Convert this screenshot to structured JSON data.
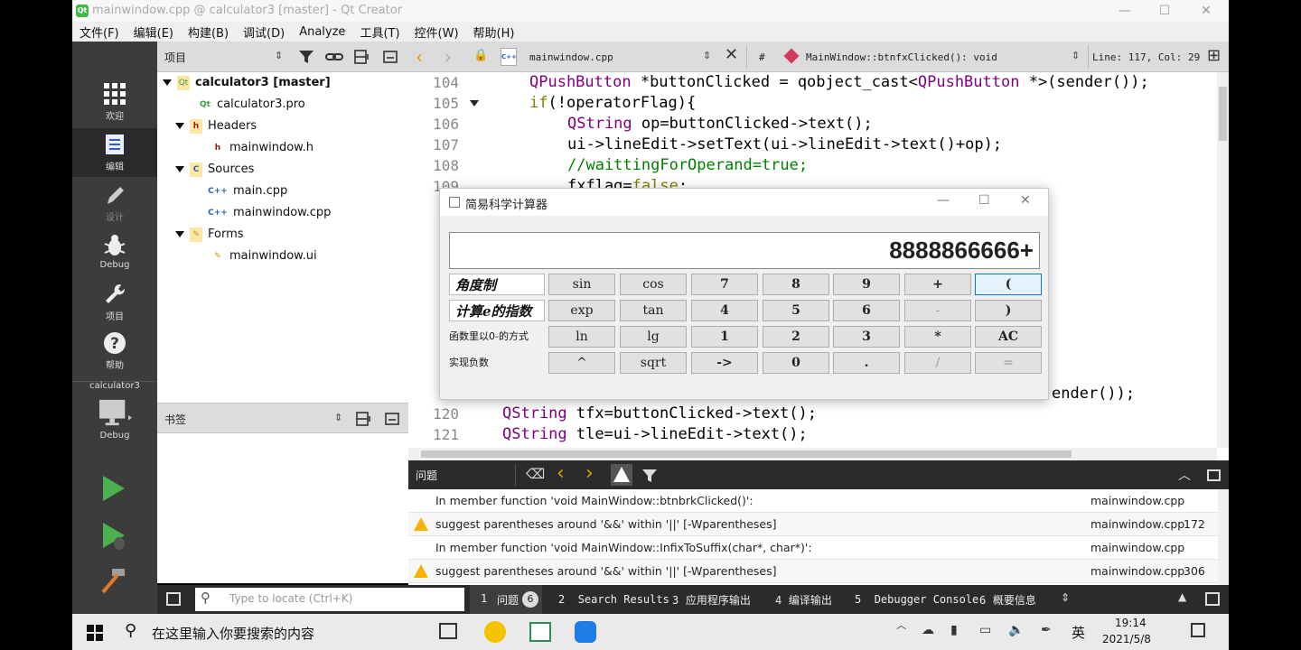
{
  "window": {
    "title": "mainwindow.cpp @ calculator3 [master] - Qt Creator",
    "minimize": "—",
    "maximize": "☐",
    "close": "✕"
  },
  "menu": [
    "文件(F)",
    "编辑(E)",
    "构建(B)",
    "调试(D)",
    "Analyze",
    "工具(T)",
    "控件(W)",
    "帮助(H)"
  ],
  "modes": [
    {
      "label": "欢迎",
      "icon": "grid-icon"
    },
    {
      "label": "编辑",
      "icon": "edit-doc-icon"
    },
    {
      "label": "设计",
      "icon": "pencil-icon"
    },
    {
      "label": "Debug",
      "icon": "bug-icon"
    },
    {
      "label": "项目",
      "icon": "wrench-icon"
    },
    {
      "label": "帮助",
      "icon": "help-icon"
    }
  ],
  "target": {
    "name": "calculator3",
    "mode": "Debug"
  },
  "project_panel": {
    "title": "项目",
    "tree": [
      {
        "label": "calculator3 [master]",
        "level": 0,
        "bold": true,
        "expanded": true,
        "icon": "project-icon"
      },
      {
        "label": "calculator3.pro",
        "level": 1,
        "icon": "pro-file-icon"
      },
      {
        "label": "Headers",
        "level": 1,
        "expanded": true,
        "icon": "headers-folder-icon"
      },
      {
        "label": "mainwindow.h",
        "level": 2,
        "icon": "header-file-icon"
      },
      {
        "label": "Sources",
        "level": 1,
        "expanded": true,
        "icon": "sources-folder-icon"
      },
      {
        "label": "main.cpp",
        "level": 2,
        "icon": "cpp-file-icon"
      },
      {
        "label": "mainwindow.cpp",
        "level": 2,
        "icon": "cpp-file-icon"
      },
      {
        "label": "Forms",
        "level": 1,
        "expanded": true,
        "icon": "forms-folder-icon"
      },
      {
        "label": "mainwindow.ui",
        "level": 2,
        "icon": "ui-file-icon"
      }
    ]
  },
  "bookmarks_panel": {
    "title": "书签"
  },
  "editor_toolbar": {
    "file": "mainwindow.cpp",
    "hash": "#",
    "function": "MainWindow::btnfxClicked(): void",
    "position": "Line: 117, Col: 29"
  },
  "code_lines": [
    {
      "n": "104",
      "fold": false,
      "indent": 8,
      "text": "QPushButton *buttonClicked = qobject_cast<QPushButton *>(sender());"
    },
    {
      "n": "105",
      "fold": true,
      "indent": 8,
      "text": "if(!operatorFlag){"
    },
    {
      "n": "106",
      "fold": false,
      "indent": 12,
      "text": "QString op=buttonClicked->text();"
    },
    {
      "n": "107",
      "fold": false,
      "indent": 12,
      "text": "ui->lineEdit->setText(ui->lineEdit->text()+op);"
    },
    {
      "n": "108",
      "fold": false,
      "indent": 12,
      "text": "//waittingForOperand=true;"
    },
    {
      "n": "109",
      "fold": false,
      "indent": 12,
      "text": "fxflag=false;"
    }
  ],
  "code_lines_bottom": [
    {
      "n": "",
      "indent": 0,
      "text": "ender());"
    },
    {
      "n": "120",
      "indent": 4,
      "text": "QString tfx=buttonClicked->text();"
    },
    {
      "n": "121",
      "indent": 4,
      "text": "QString tle=ui->lineEdit->text();"
    }
  ],
  "issues": {
    "title": "问题",
    "rows": [
      {
        "warn": false,
        "text": "In member function 'void MainWindow::btnbrkClicked()':",
        "file": "mainwindow.cpp",
        "line": ""
      },
      {
        "warn": true,
        "text": "suggest parentheses around '&&' within '||' [-Wparentheses]",
        "file": "mainwindow.cpp",
        "line": "172"
      },
      {
        "warn": false,
        "text": "In member function 'void MainWindow::InfixToSuffix(char*, char*)':",
        "file": "mainwindow.cpp",
        "line": ""
      },
      {
        "warn": true,
        "text": "suggest parentheses around '&&' within '||' [-Wparentheses]",
        "file": "mainwindow.cpp",
        "line": "306"
      }
    ]
  },
  "status_bar": {
    "locate_placeholder": "Type to locate (Ctrl+K)",
    "tabs": [
      {
        "num": "1",
        "label": "问题",
        "badge": "6"
      },
      {
        "num": "2",
        "label": "Search Results"
      },
      {
        "num": "3",
        "label": "应用程序输出"
      },
      {
        "num": "4",
        "label": "编译输出"
      },
      {
        "num": "5",
        "label": "Debugger Console"
      },
      {
        "num": "6",
        "label": "概要信息"
      }
    ]
  },
  "calculator": {
    "title": "简易科学计算器",
    "display": "8888866666+",
    "labels": [
      "角度制",
      "计算e的指数",
      "函数里以0-的方式",
      "实现负数"
    ],
    "rows": [
      [
        "sin",
        "cos",
        "7",
        "8",
        "9",
        "+",
        "("
      ],
      [
        "exp",
        "tan",
        "4",
        "5",
        "6",
        "-",
        ")"
      ],
      [
        "ln",
        "lg",
        "1",
        "2",
        "3",
        "*",
        "AC"
      ],
      [
        "^",
        "sqrt",
        "->",
        "0",
        ".",
        "/",
        "="
      ]
    ]
  },
  "taskbar": {
    "search_placeholder": "在这里输入你要搜索的内容",
    "ime": "英",
    "time": "19:14",
    "date": "2021/5/8"
  }
}
